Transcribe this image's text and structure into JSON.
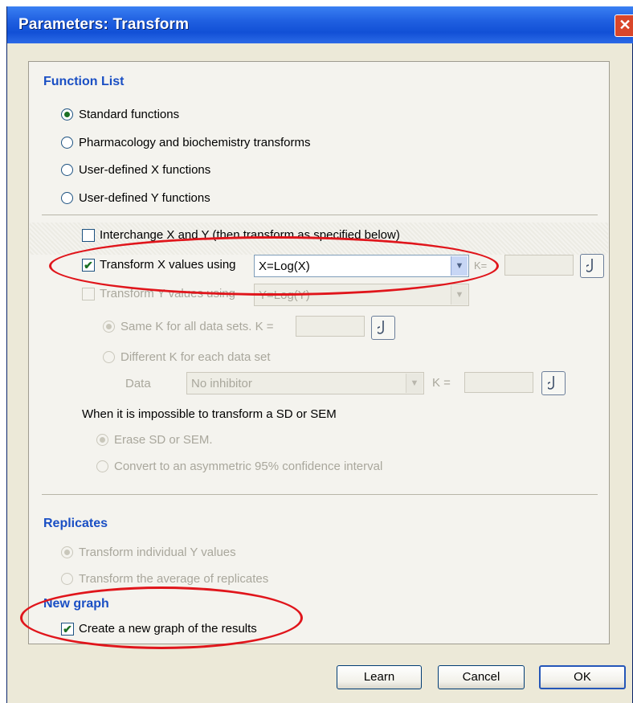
{
  "window": {
    "title": "Parameters: Transform",
    "close_glyph": "✕"
  },
  "function_list": {
    "title": "Function List",
    "options": [
      {
        "label": "Standard functions",
        "selected": true
      },
      {
        "label": "Pharmacology and biochemistry transforms",
        "selected": false
      },
      {
        "label": "User-defined X functions",
        "selected": false
      },
      {
        "label": "User-defined Y functions",
        "selected": false
      }
    ]
  },
  "transform": {
    "interchange": {
      "label": "Interchange X and Y (then transform as specified below)",
      "checked": false
    },
    "transform_x": {
      "label": "Transform X values using",
      "checked": true,
      "value": "X=Log(X)",
      "k_label": "K=",
      "k_value": ""
    },
    "transform_y": {
      "label": "Transform Y values using",
      "checked": false,
      "value": "Y=Log(Y)",
      "enabled": false
    },
    "same_k": {
      "label": "Same K for all data sets. K =",
      "selected": true,
      "k_value": ""
    },
    "different_k": {
      "label": "Different K for each data set",
      "selected": false
    },
    "data": {
      "label": "Data",
      "value": "No inhibitor",
      "k_label": "K =",
      "k_value": ""
    }
  },
  "sd_sem": {
    "title": "When it is impossible to transform a SD or SEM",
    "options": [
      {
        "label": "Erase SD or SEM.",
        "selected": true
      },
      {
        "label": "Convert to an asymmetric 95% confidence interval",
        "selected": false
      }
    ]
  },
  "replicates": {
    "title": "Replicates",
    "options": [
      {
        "label": "Transform individual Y values",
        "selected": true
      },
      {
        "label": "Transform the average of replicates",
        "selected": false
      }
    ]
  },
  "new_graph": {
    "title": "New graph",
    "create": {
      "label": "Create a new graph of the results",
      "checked": true
    }
  },
  "buttons": {
    "learn": "Learn",
    "cancel": "Cancel",
    "ok": "OK"
  },
  "icons": {
    "check_glyph": "✔",
    "dropdown": "chevron-down-icon",
    "k_button": "hook-icon"
  },
  "colors": {
    "title_bar": "#1f5fe0",
    "section_title": "#1a4fc4",
    "annotation": "#e0151b"
  }
}
